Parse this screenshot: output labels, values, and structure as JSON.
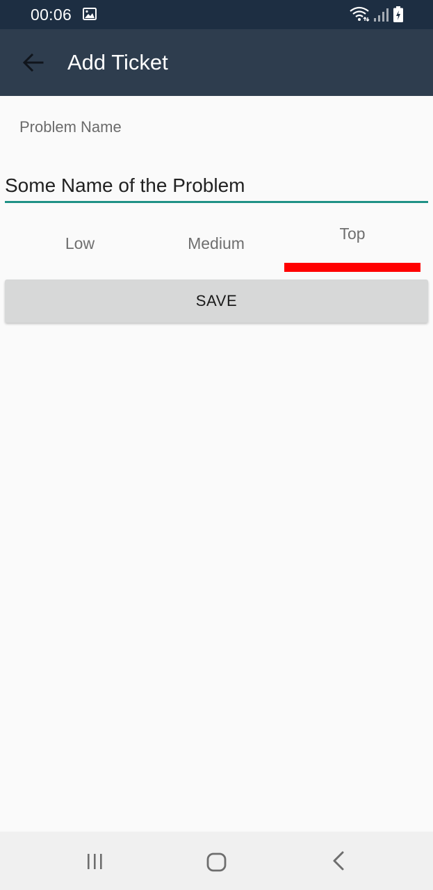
{
  "status_bar": {
    "time": "00:06",
    "icons": [
      "gallery-icon",
      "wifi-icon",
      "signal-icon",
      "battery-charging-icon"
    ]
  },
  "app_bar": {
    "title": "Add Ticket",
    "back_icon": "arrow-left-icon"
  },
  "form": {
    "problem_name_label": "Problem Name",
    "problem_name_value": "Some Name of the Problem"
  },
  "priority": {
    "options": [
      "Low",
      "Medium",
      "Top"
    ],
    "selected": "Top",
    "indicator_color": "#ff0000"
  },
  "save_button": {
    "label": "SAVE"
  },
  "nav_bar": {
    "icons": [
      "recents-icon",
      "home-icon",
      "back-icon"
    ]
  },
  "colors": {
    "status_bar": "#1d2e42",
    "app_bar": "#2e3d4e",
    "input_underline": "#1f9186",
    "button_bg": "#d7d8d8"
  }
}
